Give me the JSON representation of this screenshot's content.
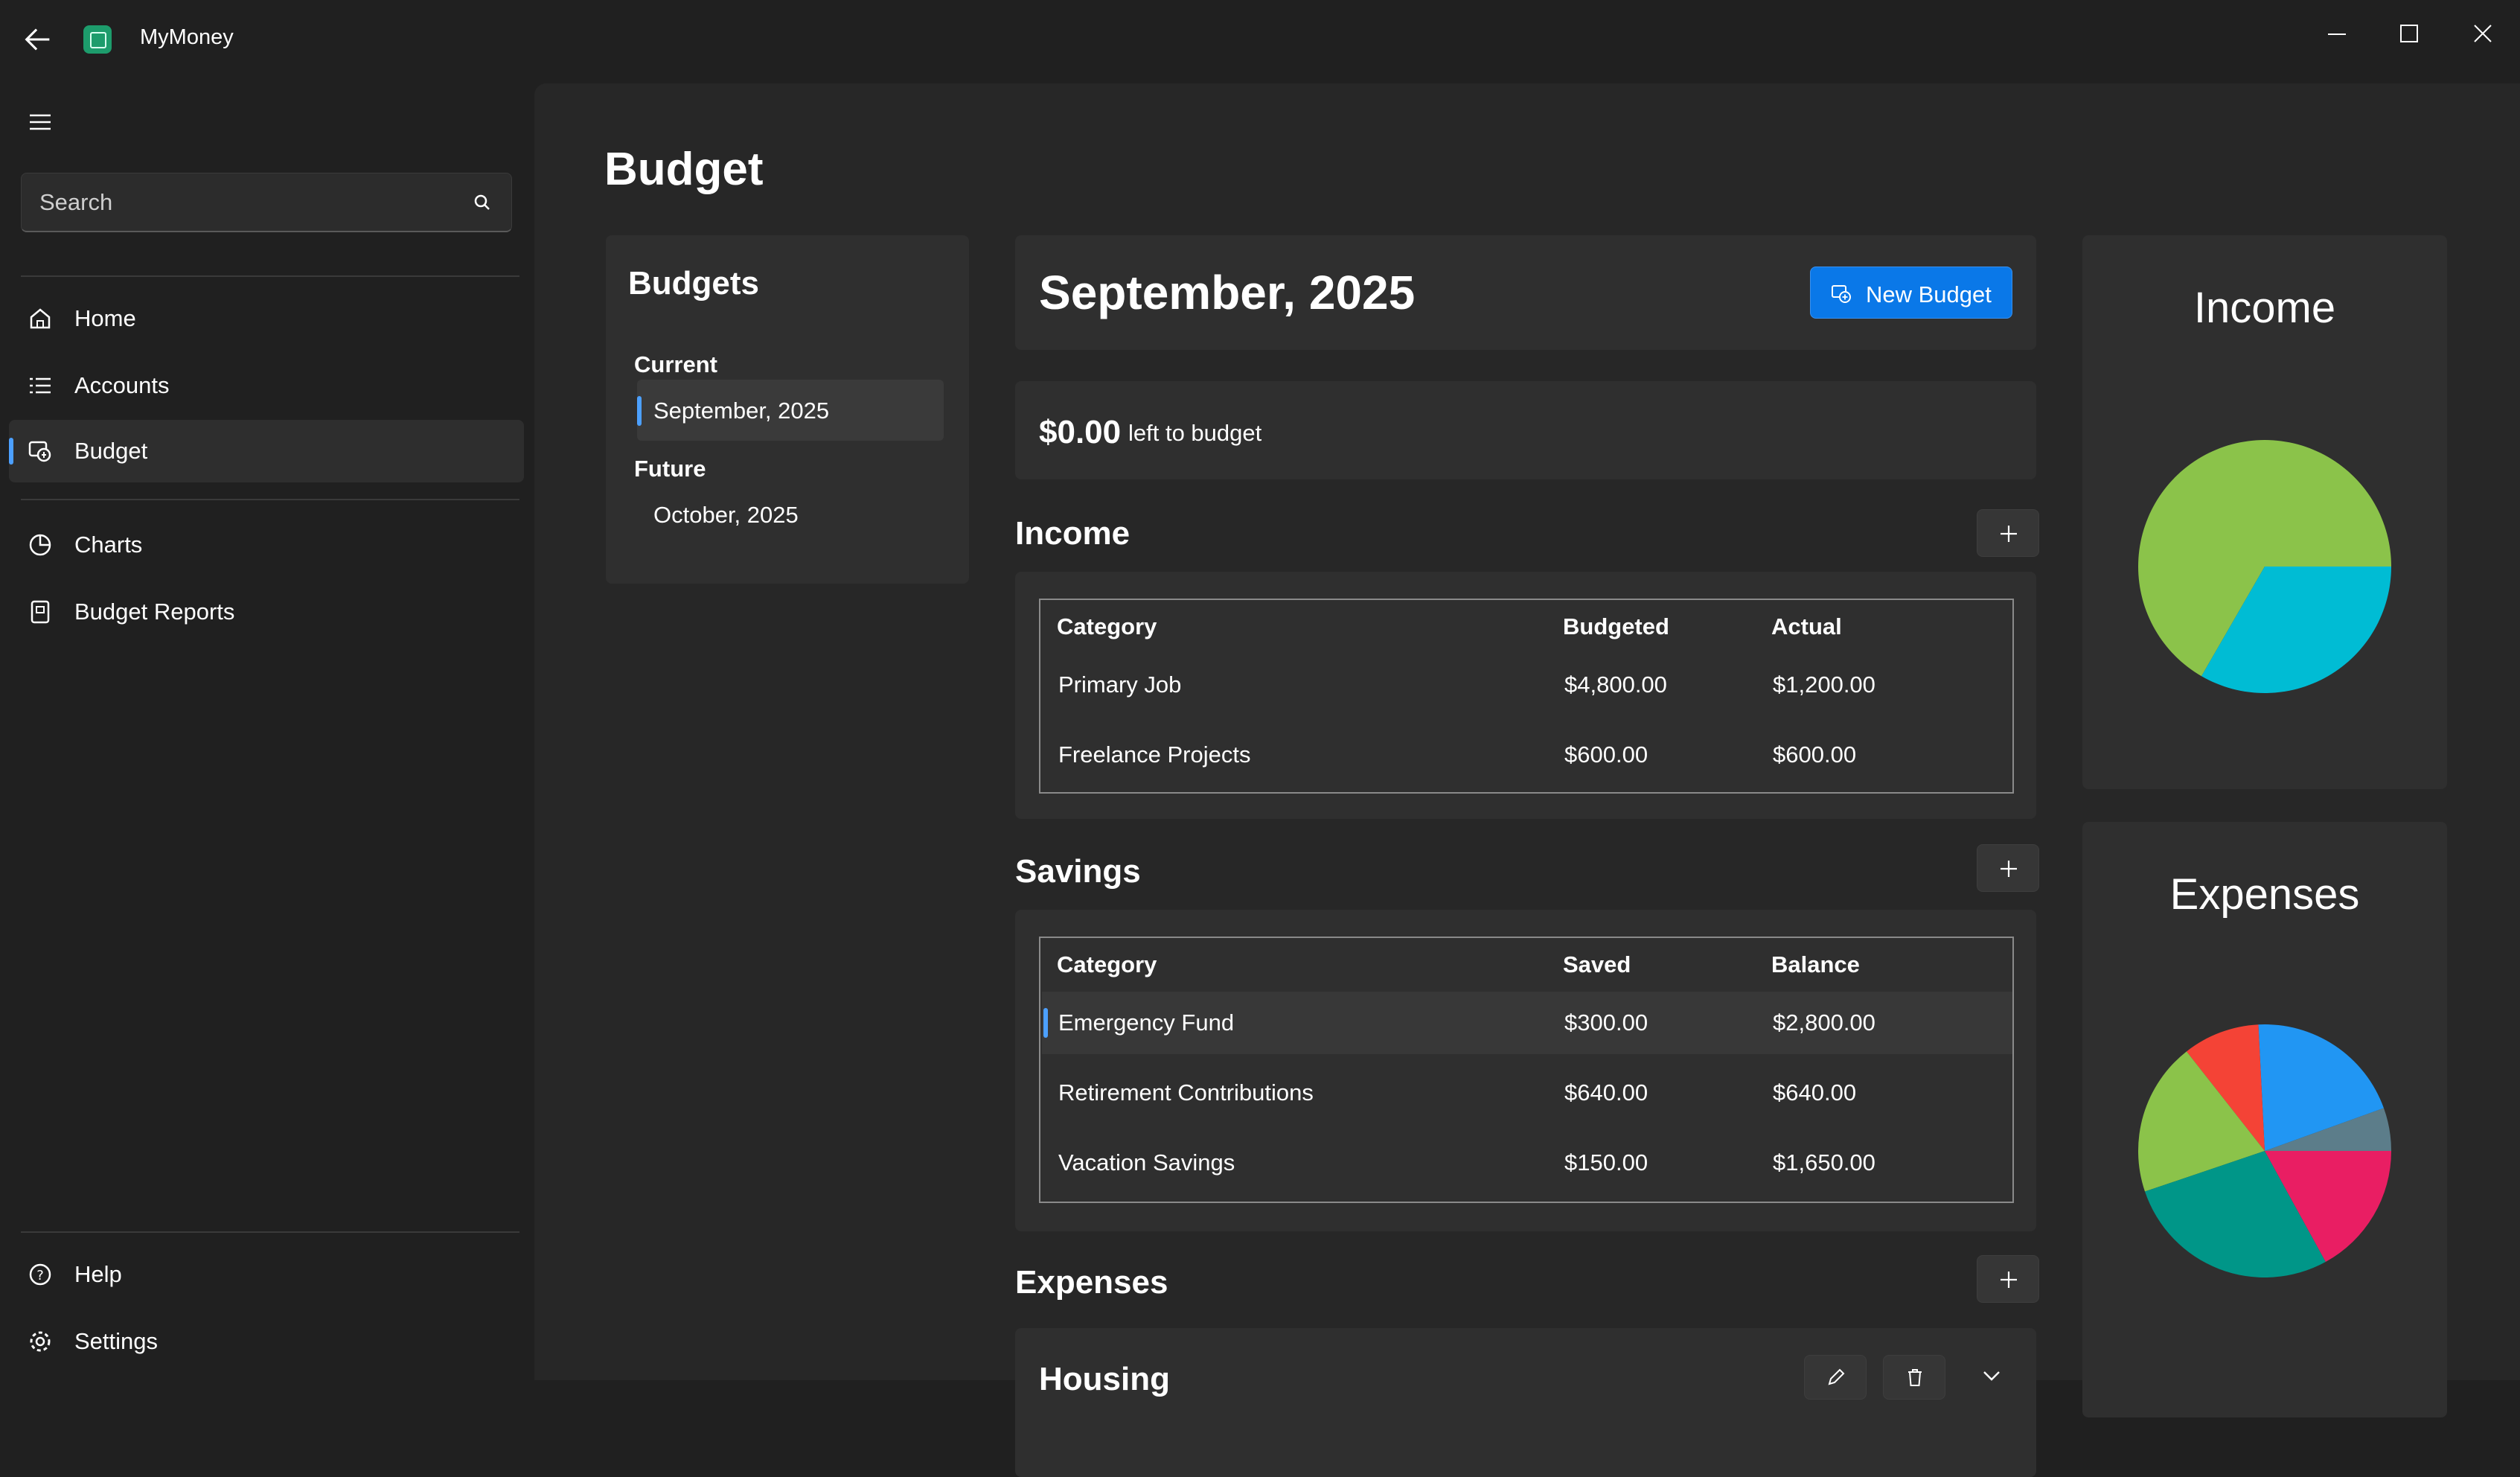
{
  "app": {
    "title": "MyMoney"
  },
  "sidebar": {
    "search_placeholder": "Search",
    "items": [
      {
        "label": "Home",
        "icon": "home-icon"
      },
      {
        "label": "Accounts",
        "icon": "list-icon"
      },
      {
        "label": "Budget",
        "icon": "budget-icon",
        "selected": true
      },
      {
        "label": "Charts",
        "icon": "chart-icon"
      },
      {
        "label": "Budget Reports",
        "icon": "report-icon"
      }
    ],
    "footer_items": [
      {
        "label": "Help",
        "icon": "help-icon"
      },
      {
        "label": "Settings",
        "icon": "gear-icon"
      }
    ]
  },
  "page": {
    "title": "Budget"
  },
  "budgets": {
    "heading": "Budgets",
    "groups": [
      {
        "header": "Current",
        "items": [
          "September, 2025"
        ]
      },
      {
        "header": "Future",
        "items": [
          "October, 2025"
        ]
      }
    ],
    "selected": "September, 2025"
  },
  "month": {
    "title": "September, 2025",
    "new_budget_label": "New Budget"
  },
  "left_to_budget": {
    "amount": "$0.00",
    "label": "left to budget"
  },
  "income": {
    "title": "Income",
    "headers": [
      "Category",
      "Budgeted",
      "Actual"
    ],
    "rows": [
      [
        "Primary Job",
        "$4,800.00",
        "$1,200.00"
      ],
      [
        "Freelance Projects",
        "$600.00",
        "$600.00"
      ]
    ]
  },
  "savings": {
    "title": "Savings",
    "headers": [
      "Category",
      "Saved",
      "Balance"
    ],
    "rows": [
      [
        "Emergency Fund",
        "$300.00",
        "$2,800.00"
      ],
      [
        "Retirement Contributions",
        "$640.00",
        "$640.00"
      ],
      [
        "Vacation Savings",
        "$150.00",
        "$1,650.00"
      ]
    ],
    "selected_row": 0
  },
  "expenses": {
    "title": "Expenses",
    "first_category": "Housing"
  },
  "charts": {
    "income": {
      "title": "Income"
    },
    "expenses": {
      "title": "Expenses"
    }
  },
  "chart_data": [
    {
      "type": "pie",
      "title": "Income",
      "slices": [
        {
          "value": 1200,
          "color": "#8bc34a"
        },
        {
          "value": 600,
          "color": "#00bcd4"
        }
      ]
    },
    {
      "type": "pie",
      "title": "Expenses",
      "slices": [
        {
          "value": 0.055,
          "color": "#5c7d8a"
        },
        {
          "value": 0.203,
          "color": "#2196f3"
        },
        {
          "value": 0.098,
          "color": "#f44336"
        },
        {
          "value": 0.196,
          "color": "#8bc34a"
        },
        {
          "value": 0.278,
          "color": "#009688"
        },
        {
          "value": 0.17,
          "color": "#e91e63"
        }
      ]
    }
  ],
  "colors": {
    "accent": "#0a78e8",
    "selection_indicator": "#4ca0ff",
    "background": "#202020",
    "card": "#2f2f2f"
  }
}
